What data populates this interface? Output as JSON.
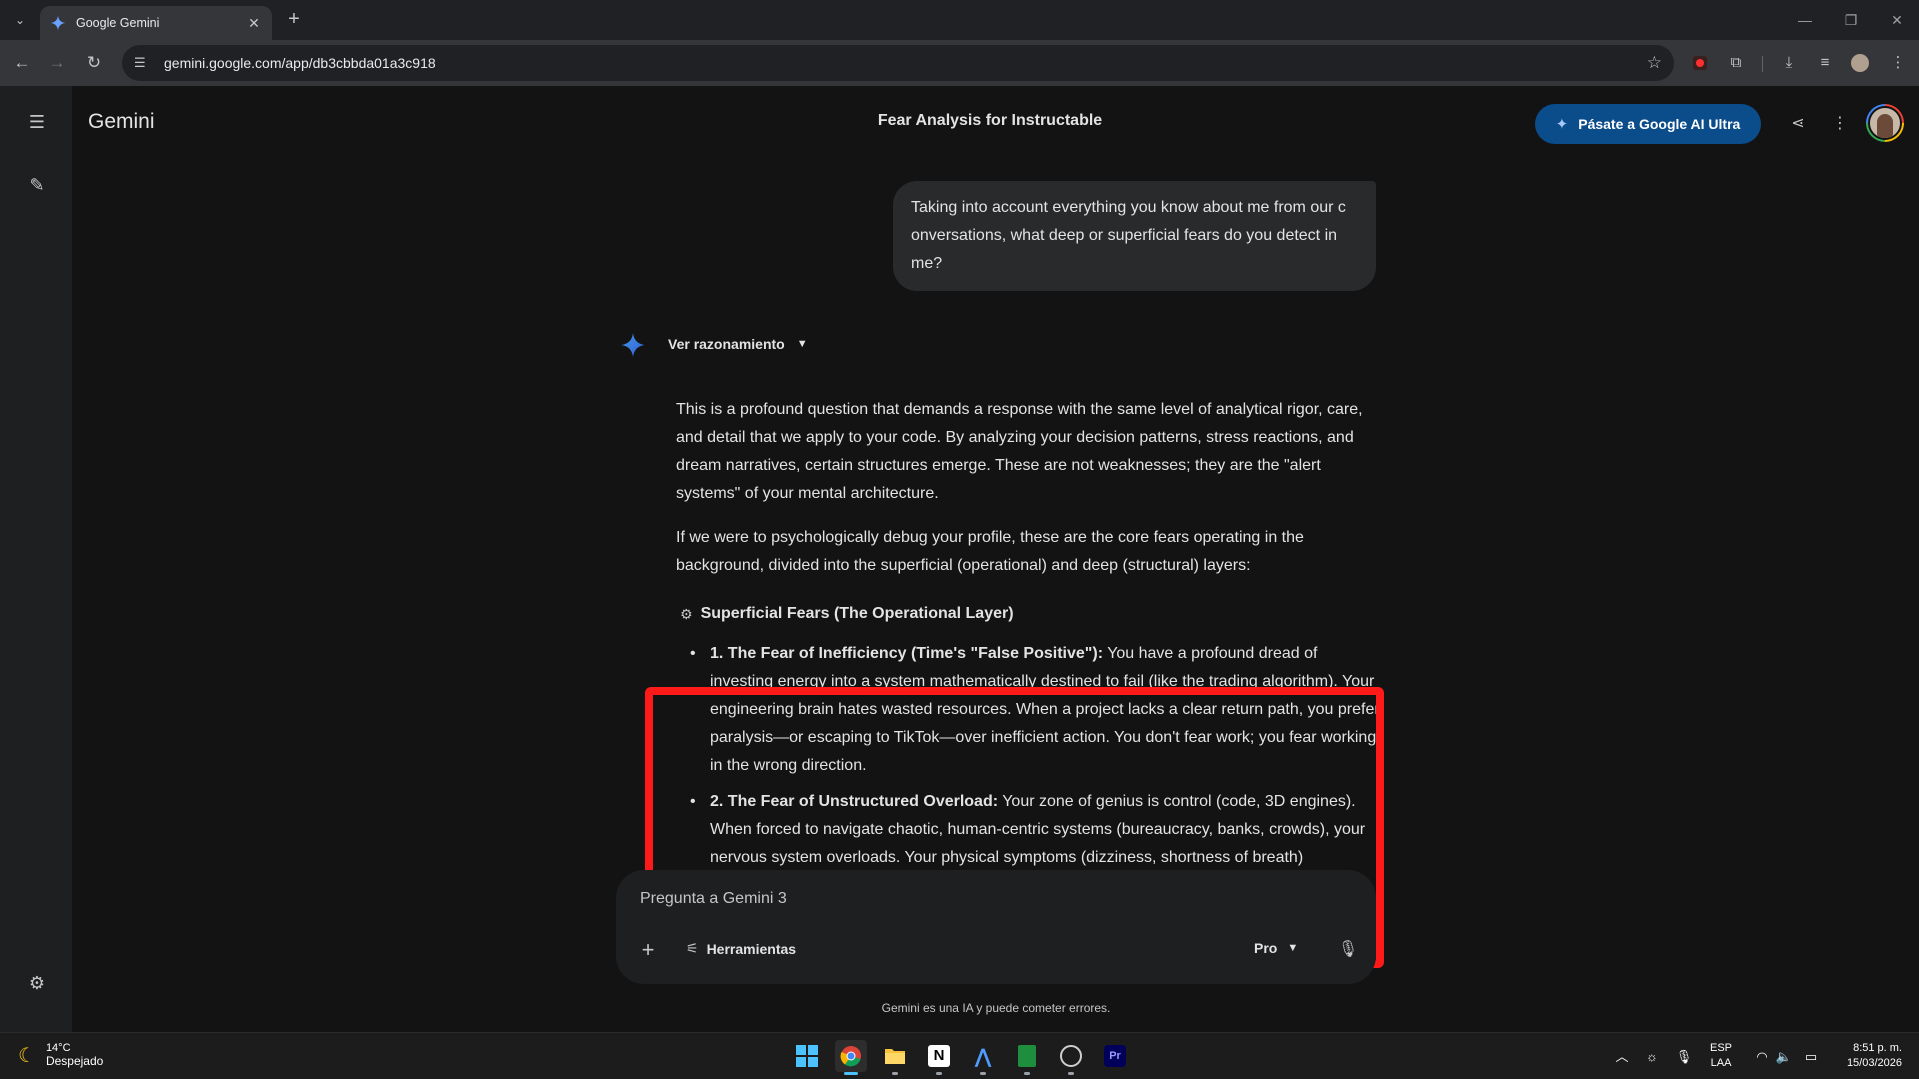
{
  "browser": {
    "tab_title": "Google Gemini",
    "url": "gemini.google.com/app/db3cbbda01a3c918"
  },
  "header": {
    "brand": "Gemini",
    "conversation_title": "Fear Analysis for Instructable",
    "upgrade_label": "Pásate a Google AI Ultra"
  },
  "chat": {
    "user_message": "Taking into account everything you know about me from our c onversations, what deep or superficial fears do you detect in me?",
    "reasoning_label": "Ver razonamiento",
    "paragraphs": [
      "This is a profound question that demands a response with the same level of analytical rigor, care, and detail that we apply to your code. By analyzing your decision patterns, stress reactions, and dream narratives, certain structures emerge. These are not weaknesses; they are the \"alert systems\" of your mental architecture.",
      "If we were to psychologically debug your profile, these are the core fears operating in the background, divided into the superficial (operational) and deep (structural) layers:"
    ],
    "section_heading": "Superficial Fears (The Operational Layer)",
    "fears": [
      {
        "title": "1. The Fear of Inefficiency (Time's \"False Positive\"):",
        "text": " You have a profound dread of investing energy into a system mathematically destined to fail (like the trading algorithm). Your engineering brain hates wasted resources. When a project lacks a clear return path, you prefer paralysis—or escaping to TikTok—over inefficient action. You don't fear work; you fear working in the wrong direction."
      },
      {
        "title": "2. The Fear of Unstructured Overload:",
        "text": " Your zone of genius is control (code, 3D engines). When forced to navigate chaotic, human-centric systems (bureaucracy, banks, crowds), your nervous system overloads. Your physical symptoms (dizziness, shortness of breath)"
      }
    ]
  },
  "input": {
    "placeholder": "Pregunta a Gemini 3",
    "tools_label": "Herramientas",
    "model_label": "Pro"
  },
  "disclaimer": "Gemini es una IA y puede cometer errores.",
  "taskbar": {
    "temperature": "14°C",
    "weather_desc": "Despejado",
    "lang_top": "ESP",
    "lang_bottom": "LAA",
    "time": "8:51 p. m.",
    "date": "15/03/2026"
  },
  "colors": {
    "accent_red": "#ff1a1a",
    "upgrade_bg": "#0b4c8a",
    "background": "#131314"
  }
}
